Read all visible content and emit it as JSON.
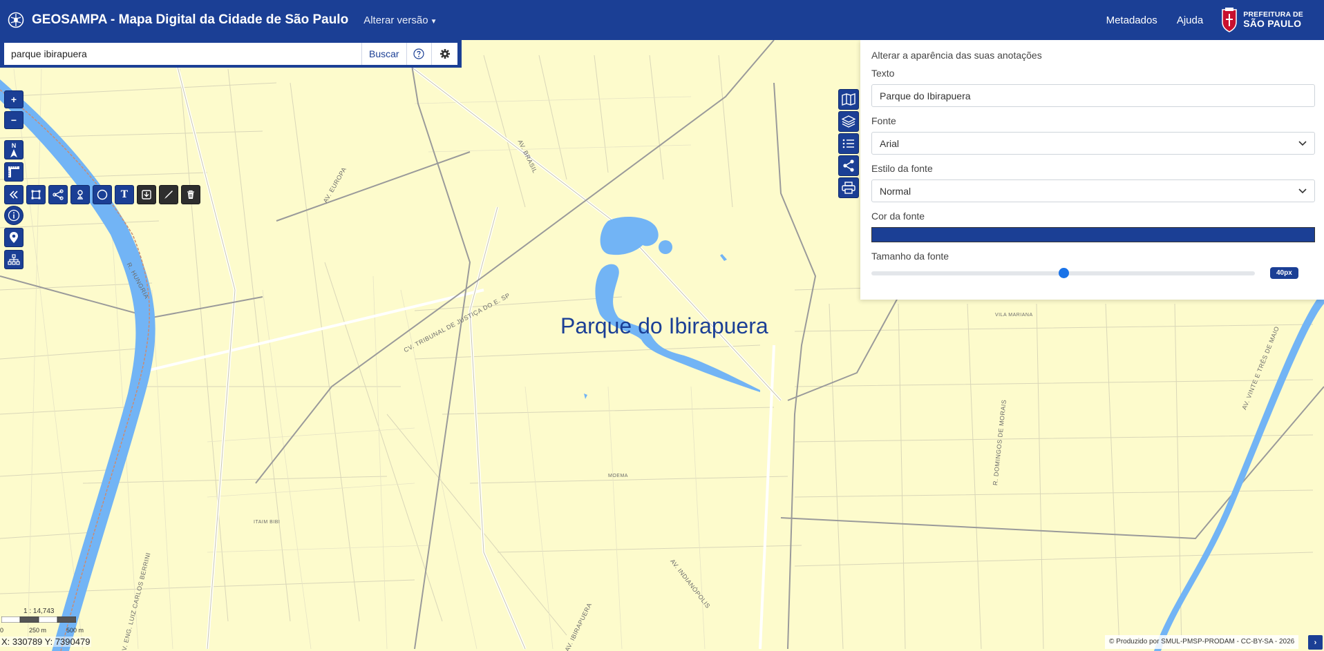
{
  "navbar": {
    "title": "GEOSAMPA - Mapa Digital da Cidade de São Paulo",
    "version_menu": "Alterar versão",
    "links": [
      "Metadados",
      "Ajuda"
    ],
    "prefeitura_line1": "PREFEITURA DE",
    "prefeitura_line2": "SÃO PAULO",
    "brand_color": "#1b3f95"
  },
  "search": {
    "value": "parque ibirapuera",
    "button_label": "Buscar"
  },
  "map_tools": {
    "zoom_in": "+",
    "zoom_out": "−",
    "north": "N",
    "text_tool": "T"
  },
  "map_labels": {
    "av_brasil": "AV. BRASIL",
    "av_europa": "AV. EUROPA",
    "r_hungria": "R. HUNGRIA",
    "cv_tribunal": "CV. TRIBUNAL DE JUSTIÇA DO E. SP",
    "vila_mariana": "VILA MARIANA",
    "r_domingos": "R. DOMINGOS DE MORAIS",
    "moema": "MOEMA",
    "itaim_bibi": "ITAIM BIBI",
    "av_indianopolis": "AV. INDIANÓPOLIS",
    "av_ibirapuera": "AV. IBIRAPUERA",
    "av_luiz_carlos_berrini": "AV. ENG. LUIZ CARLOS BERRINI",
    "av_23_maio": "AV. VINTE E TRÊS DE MAIO"
  },
  "annotation": {
    "text": "Parque do Ibirapuera"
  },
  "panel": {
    "title": "Alterar a aparência das suas anotações",
    "texto_label": "Texto",
    "texto_value": "Parque do Ibirapuera",
    "fonte_label": "Fonte",
    "fonte_value": "Arial",
    "estilo_label": "Estilo da fonte",
    "estilo_value": "Normal",
    "cor_label": "Cor da fonte",
    "cor_value": "#1b3f95",
    "tamanho_label": "Tamanho da fonte",
    "tamanho_value": "40px",
    "tamanho_fraction": 0.5
  },
  "bottom": {
    "scale_ratio": "1 : 14,743",
    "scale_0": "0",
    "scale_250": "250 m",
    "scale_500": "500 m",
    "coords": "X: 330789 Y: 7390479",
    "attribution": "© Produzido por SMUL-PMSP-PRODAM - CC-BY-SA - 2026",
    "attribution_toggle": "›"
  }
}
